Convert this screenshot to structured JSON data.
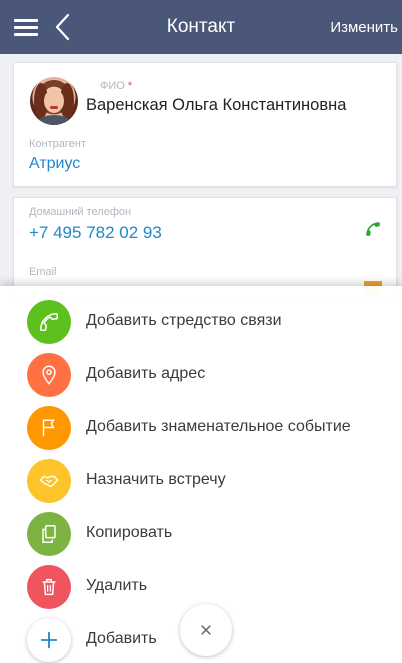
{
  "header": {
    "title": "Контакт",
    "action_label": "Изменить",
    "color": "#4a5779"
  },
  "contact": {
    "fio_label": "ФИО",
    "fio_required_mark": "*",
    "full_name": "Варенская Ольга Константиновна",
    "account_label": "Контрагент",
    "account_value": "Атриус",
    "home_phone_label": "Домашний телефон",
    "home_phone_value": "+7 495 782 02 93",
    "email_label": "Email"
  },
  "menu": {
    "items": [
      {
        "label": "Добавить стредство связи",
        "icon": "phone-icon",
        "color": "#5cc01f"
      },
      {
        "label": "Добавить адрес",
        "icon": "map-pin-icon",
        "color": "#ff7043"
      },
      {
        "label": "Добавить знаменательное событие",
        "icon": "flag-icon",
        "color": "#ff9800"
      },
      {
        "label": "Назначить встречу",
        "icon": "handshake-icon",
        "color": "#fdc32b"
      },
      {
        "label": "Копировать",
        "icon": "copy-icon",
        "color": "#7cb342"
      },
      {
        "label": "Удалить",
        "icon": "trash-icon",
        "color": "#f0545f"
      },
      {
        "label": "Добавить",
        "icon": "plus-icon",
        "color": "#ffffff"
      }
    ],
    "close_icon": "close-icon"
  },
  "colors": {
    "link": "#1e88c9",
    "phone_icon": "#2aa52a",
    "mail_icon": "#f0a22e"
  }
}
